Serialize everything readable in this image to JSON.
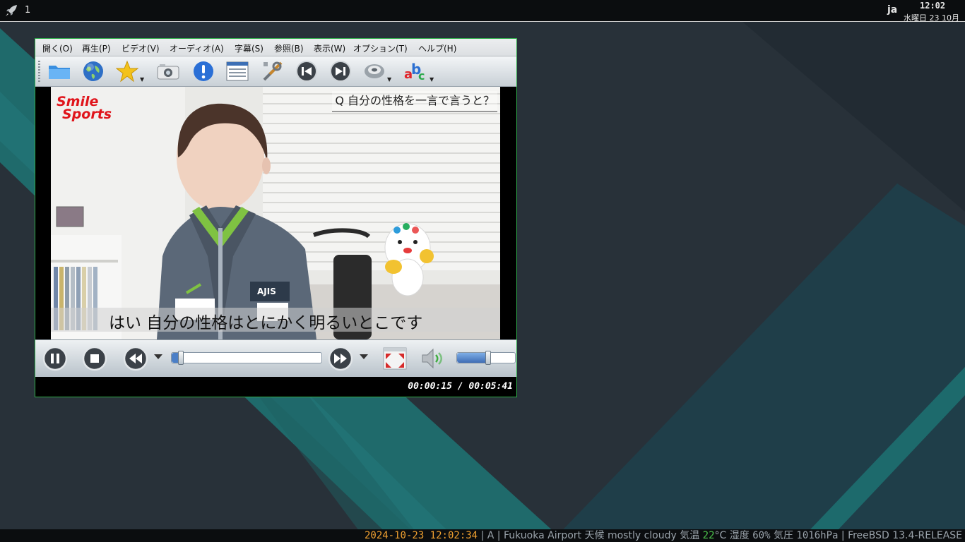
{
  "top_panel": {
    "workspace": "1",
    "language": "ja",
    "clock_time": "12:02",
    "clock_date": "水曜日 23 10月"
  },
  "player": {
    "menu": [
      "開く(O)",
      "再生(P)",
      "ビデオ(V)",
      "オーディオ(A)",
      "字幕(S)",
      "参照(B)",
      "表示(W)",
      "オプション(T)",
      "ヘルプ(H)"
    ],
    "toolbar_icons": [
      "open-folder-icon",
      "url-globe-icon",
      "favorites-star-icon",
      "screenshot-camera-icon",
      "info-icon",
      "playlist-icon",
      "preferences-tools-icon",
      "previous-icon",
      "next-icon",
      "audio-track-icon",
      "subtitle-abc-icon"
    ],
    "video": {
      "logo_line1": "Smile",
      "logo_line2": "Sports",
      "question": "Q 自分の性格を一言で言うと？",
      "subtitle": "はい 自分の性格はとにかく明るいとこです"
    },
    "controls": {
      "seek_fraction": 0.044,
      "volume_fraction": 0.52
    },
    "time_display": "00:00:15 / 00:05:41"
  },
  "status_bar": {
    "datetime": "2024-10-23 12:02:34",
    "sep1": " | ",
    "layout": "A",
    "sep2": " | ",
    "location": "Fukuoka Airport",
    "weather_label": " 天候 ",
    "weather": "mostly cloudy",
    "temp_label": "  気温 ",
    "temp_value": "22",
    "temp_unit": "°C",
    "humidity_label": " 湿度 ",
    "humidity_value": "60%",
    "pressure_label": " 気圧 ",
    "pressure_value": "1016hPa",
    "sep3": " | ",
    "os": "FreeBSD 13.4-RELEASE"
  },
  "colors": {
    "window_border": "#2fae4a",
    "status_orange": "#f0a030",
    "status_green": "#4cc44c"
  }
}
